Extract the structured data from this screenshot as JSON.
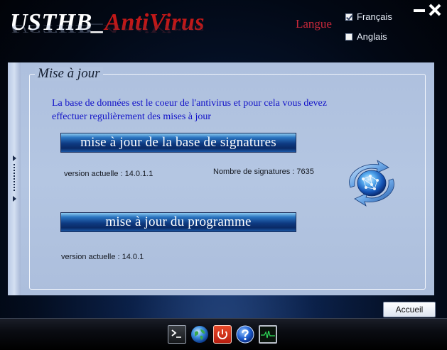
{
  "app": {
    "title_part1": "USTHB_",
    "title_part2": "AntiVirus"
  },
  "language": {
    "label": "Langue",
    "options": [
      {
        "label": "Français",
        "checked": true
      },
      {
        "label": "Anglais",
        "checked": false
      }
    ]
  },
  "section": {
    "title": "Mise à jour",
    "description_line1": "La base de données est le coeur de l'antivirus et pour cela vous devez",
    "description_line2": "effectuer regulièrement des mises à jour"
  },
  "signatures_update": {
    "button_label": "mise à jour de la base de signatures",
    "version_text": "version actuelle : 14.0.1.1",
    "count_text": "Nombre de signatures : 7635"
  },
  "program_update": {
    "button_label": "mise à jour du programme",
    "version_text": "version actuelle : 14.0.1"
  },
  "footer": {
    "home_button_label": "Accueil"
  },
  "taskbar": {
    "icons": [
      "terminal-icon",
      "globe-icon",
      "power-icon",
      "help-icon",
      "monitor-icon"
    ]
  },
  "colors": {
    "title_red": "#c01818",
    "description_blue": "#1212c8",
    "panel_bg": "#b0c2df",
    "button_blue": "#0e3a82"
  }
}
